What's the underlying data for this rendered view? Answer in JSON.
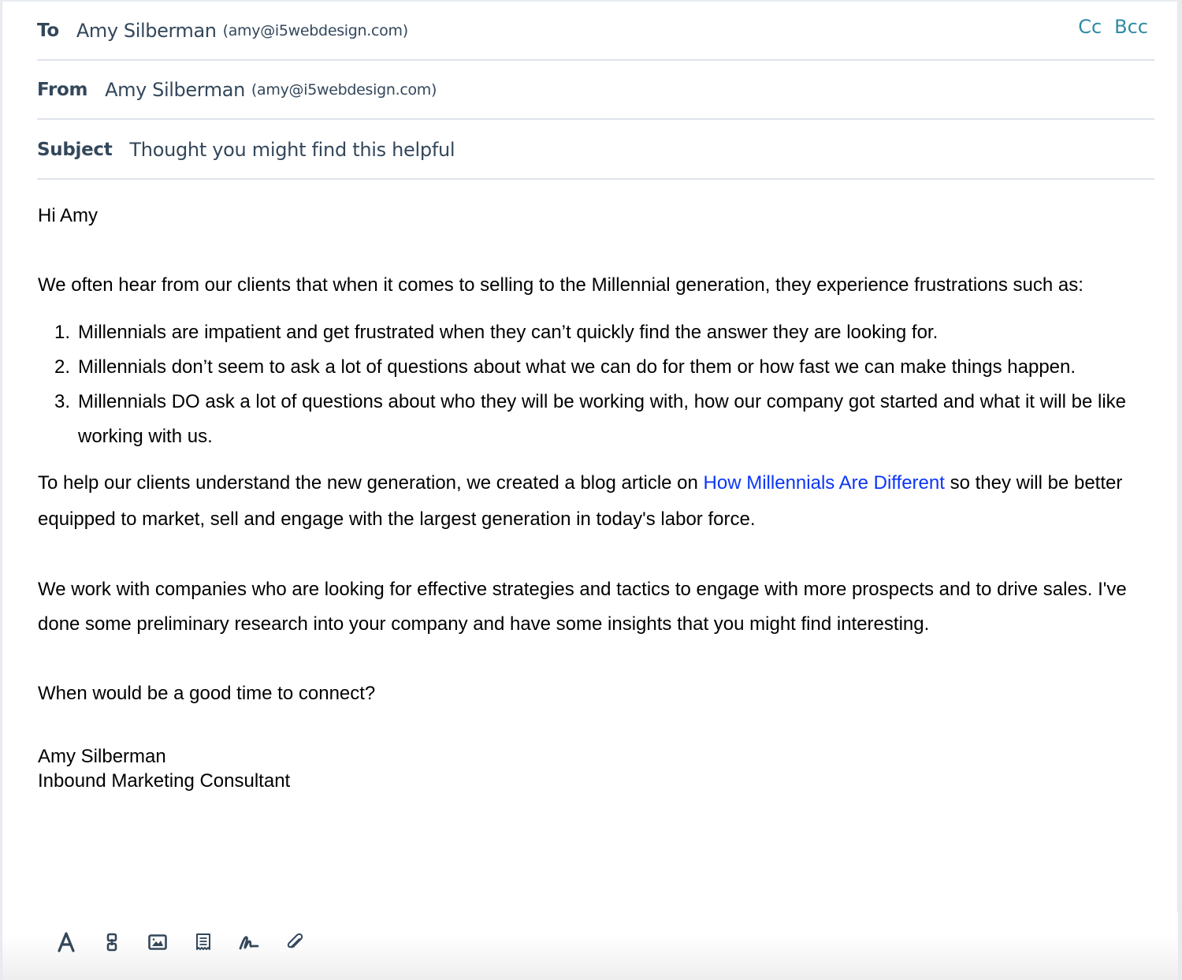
{
  "header": {
    "to": {
      "label": "To",
      "name": "Amy Silberman",
      "email": "(amy@i5webdesign.com)"
    },
    "cc_label": "Cc",
    "bcc_label": "Bcc",
    "from": {
      "label": "From",
      "name": "Amy Silberman",
      "email": "(amy@i5webdesign.com)"
    },
    "subject": {
      "label": "Subject",
      "value": "Thought you might find this helpful"
    }
  },
  "body": {
    "greeting": "Hi Amy",
    "intro": "We often hear from our clients that when it comes to selling to the Millennial generation, they experience frustrations such as:",
    "list": [
      "Millennials are impatient and get frustrated when they can’t quickly find the answer they are looking for.",
      "Millennials don’t seem to ask a lot of questions about what we can do for them or how fast we can make things happen.",
      "Millennials DO ask a lot of questions about who they will be working with, how our company got started and what it will be like working with us."
    ],
    "para2_before": "To help our clients understand the new generation, we created a blog article on ",
    "para2_link": "How Millennials Are Different",
    "para2_after": " so they will be better equipped to market, sell and engage with the largest generation in today's labor force.",
    "para3": "We work with companies who are looking for effective strategies and tactics to engage with more prospects and to drive sales.  I've done some preliminary research into your company and have some insights that you might find interesting.",
    "closing": "When would be a good time to connect?",
    "signature_name": "Amy Silberman",
    "signature_title": "Inbound Marketing Consultant"
  },
  "toolbar": {
    "icons": [
      "text-format-icon",
      "link-icon",
      "image-icon",
      "document-icon",
      "signature-icon",
      "attachment-icon"
    ]
  },
  "colors": {
    "label": "#33475b",
    "accent": "#2e8ba6",
    "link": "#0b35f5"
  }
}
